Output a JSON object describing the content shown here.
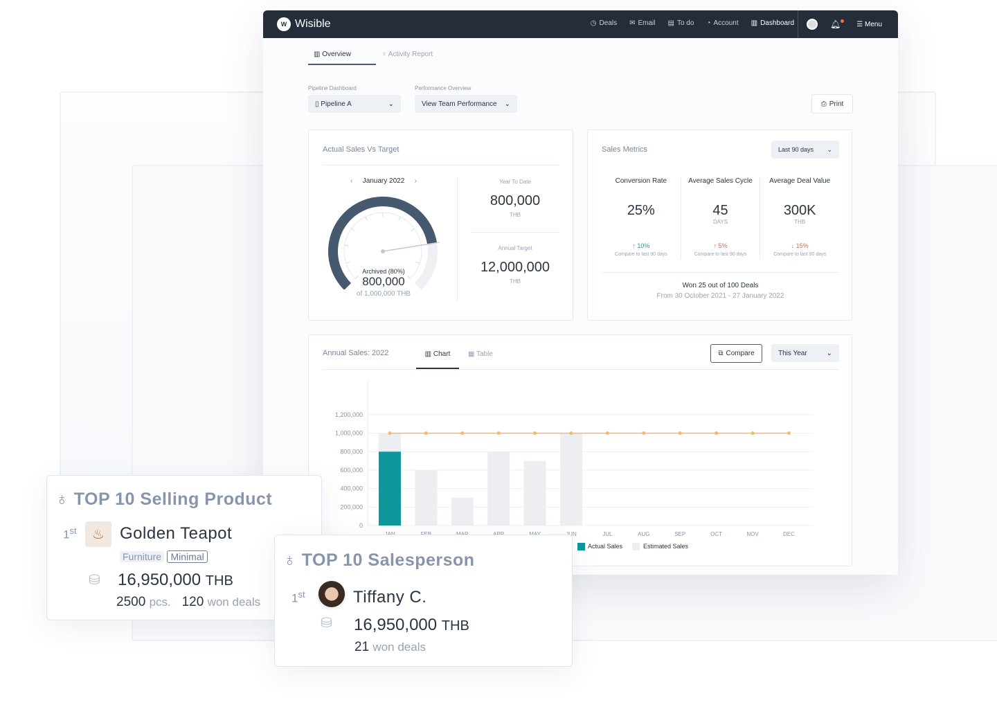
{
  "nav": {
    "brand": "Wisible",
    "items": [
      {
        "icon": "dollar-circle-icon",
        "label": "Deals"
      },
      {
        "icon": "mail-icon",
        "label": "Email"
      },
      {
        "icon": "todo-icon",
        "label": "To do"
      },
      {
        "icon": "account-icon",
        "label": "Account"
      },
      {
        "icon": "bar-chart-icon",
        "label": "Dashboard"
      }
    ],
    "menu": "Menu"
  },
  "tabs": [
    {
      "label": "Overview",
      "active": true
    },
    {
      "label": "Activity Report",
      "active": false
    }
  ],
  "filters": {
    "pipeline_label": "Pipeline Dashboard",
    "pipeline_value": "Pipeline A",
    "performance_label": "Performance Overview",
    "performance_value": "View Team Performance",
    "print": "Print"
  },
  "actual_vs_target": {
    "title": "Actual Sales Vs Target",
    "month": "January 2022",
    "gauge_percent": 80,
    "archived_label": "Archived (80%)",
    "archived_value": "800,000",
    "of_label": "of 1,000,000 THB",
    "ytd_label": "Year To Date",
    "ytd_value": "800,000",
    "ytd_unit": "THB",
    "annual_label": "Annual Target",
    "annual_value": "12,000,000",
    "annual_unit": "THB"
  },
  "sales_metrics": {
    "title": "Sales Metrics",
    "range": "Last 90 days",
    "metrics": [
      {
        "label": "Conversion Rate",
        "value": "25%",
        "unit": "",
        "change": "10%",
        "dir": "up",
        "color": "#1a9a9e",
        "compare": "Compare to last 90 days"
      },
      {
        "label": "Average Sales Cycle",
        "value": "45",
        "unit": "DAYS",
        "change": "5%",
        "dir": "up",
        "color": "#c0735a",
        "compare": "Compare to last 90 days"
      },
      {
        "label": "Average Deal Value",
        "value": "300K",
        "unit": "THB",
        "change": "15%",
        "dir": "down",
        "color": "#c0735a",
        "compare": "Compare to last 90 days"
      }
    ],
    "won": "Won 25 out of 100 Deals",
    "period": "From 30 October 2021 - 27 January 2022"
  },
  "annual": {
    "title": "Annual Sales: 2022",
    "tab_chart": "Chart",
    "tab_table": "Table",
    "compare": "Compare",
    "range": "This Year"
  },
  "chart_data": {
    "type": "bar",
    "categories": [
      "JAN",
      "FEB",
      "MAR",
      "APR",
      "MAY",
      "JUN",
      "JUL",
      "AUG",
      "SEP",
      "OCT",
      "NOV",
      "DEC"
    ],
    "ylim": [
      0,
      1200000
    ],
    "yticks": [
      "0",
      "200,000",
      "400,000",
      "600,000",
      "800,000",
      "1,000,000",
      "1,200,000"
    ],
    "series": [
      {
        "name": "Actual Sales",
        "type": "bar",
        "color": "#0f979c",
        "values": [
          800000,
          null,
          null,
          null,
          null,
          null,
          null,
          null,
          null,
          null,
          null,
          null
        ]
      },
      {
        "name": "Estimated Sales",
        "type": "bar",
        "color": "#eceef2",
        "values": [
          1000000,
          600000,
          300000,
          800000,
          700000,
          1000000,
          null,
          null,
          null,
          null,
          null,
          null
        ]
      },
      {
        "type": "line",
        "color": "#f5b86a",
        "values": [
          1000000,
          1000000,
          1000000,
          1000000,
          1000000,
          1000000,
          1000000,
          1000000,
          1000000,
          1000000,
          1000000,
          1000000
        ]
      }
    ],
    "legend": [
      "Actual Sales",
      "Estimated Sales"
    ],
    "grid": true
  },
  "top_product": {
    "title": "TOP 10 Selling Product",
    "rank": "1",
    "rank_suffix": "st",
    "name": "Golden Teapot",
    "tags": [
      "Furniture",
      "Minimal"
    ],
    "amount": "16,950,000",
    "currency": "THB",
    "pcs": "2500",
    "pcs_unit": "pcs.",
    "deals": "120",
    "deals_unit": "won deals"
  },
  "top_sales": {
    "title": "TOP 10 Salesperson",
    "rank": "1",
    "rank_suffix": "st",
    "name": "Tiffany C.",
    "amount": "16,950,000",
    "currency": "THB",
    "deals": "21",
    "deals_unit": "won deals"
  }
}
